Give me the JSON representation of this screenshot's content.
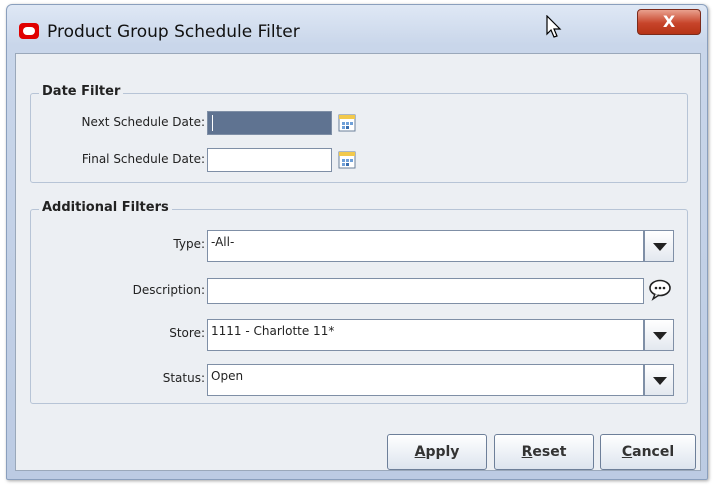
{
  "window": {
    "title": "Product Group Schedule Filter",
    "close_label": "X"
  },
  "date_filter": {
    "title": "Date Filter",
    "next_label": "Next Schedule Date:",
    "next_value": "",
    "final_label": "Final Schedule Date:",
    "final_value": ""
  },
  "additional_filters": {
    "title": "Additional Filters",
    "type_label": "Type:",
    "type_value": "-All-",
    "description_label": "Description:",
    "description_value": "",
    "store_label": "Store:",
    "store_value": "1111 - Charlotte 11*",
    "status_label": "Status:",
    "status_value": "Open"
  },
  "buttons": {
    "apply": {
      "first": "A",
      "rest": "pply"
    },
    "reset": {
      "first": "R",
      "rest": "eset"
    },
    "cancel": {
      "first": "C",
      "rest": "ancel"
    }
  }
}
